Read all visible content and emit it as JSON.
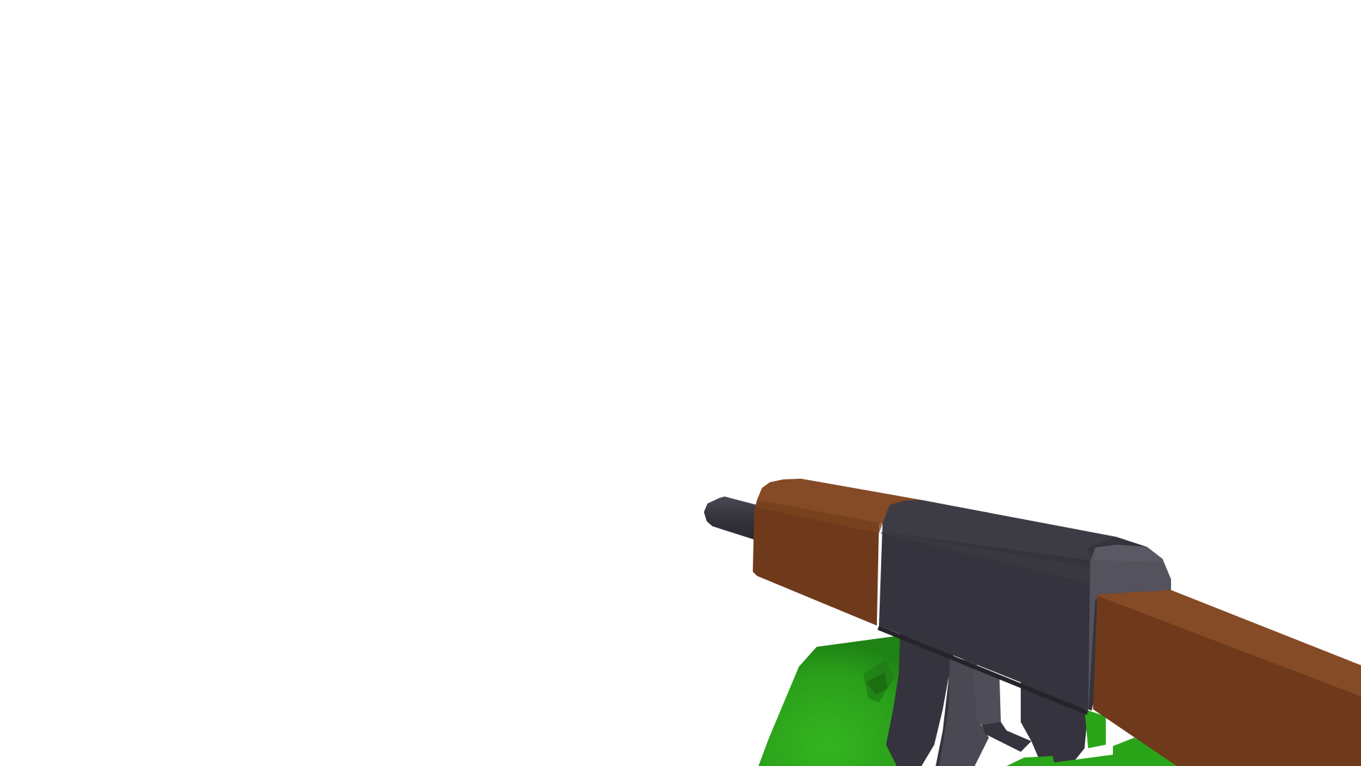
{
  "scene": {
    "background_color": "#ffffff",
    "view": "first-person",
    "held_item": "rifle"
  },
  "palette": {
    "wood_dark": "#6e3a1b",
    "wood_light": "#854b26",
    "metal_dark": "#35333d",
    "metal_mid": "#3d3b44",
    "metal_light": "#4f4d57",
    "metal_lighter": "#5a5862",
    "hand_green": "#2aa51a",
    "hand_green_dark": "#1f7a15"
  }
}
